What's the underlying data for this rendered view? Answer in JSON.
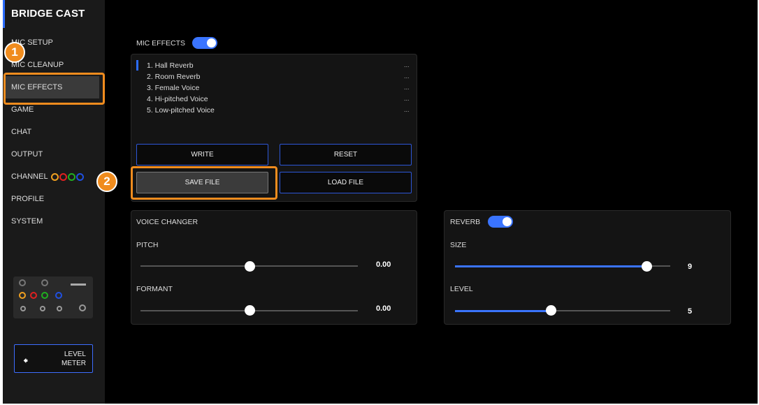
{
  "app": {
    "title": "BRIDGE CAST"
  },
  "sidebar": {
    "items": [
      {
        "label": "MIC SETUP"
      },
      {
        "label": "MIC CLEANUP"
      },
      {
        "label": "MIC EFFECTS"
      },
      {
        "label": "GAME"
      },
      {
        "label": "CHAT"
      },
      {
        "label": "OUTPUT"
      },
      {
        "label": "CHANNEL"
      },
      {
        "label": "PROFILE"
      },
      {
        "label": "SYSTEM"
      }
    ],
    "channel_colors": [
      "#f0a020",
      "#e02020",
      "#20b020",
      "#2050e0"
    ],
    "level_meter_label": "LEVEL\nMETER",
    "level_meter_icon": "arrow-left-icon"
  },
  "mic_effects": {
    "header": "MIC EFFECTS",
    "enabled": true,
    "presets": [
      {
        "label": "1. Hall Reverb",
        "menu": "..."
      },
      {
        "label": "2. Room Reverb",
        "menu": "..."
      },
      {
        "label": "3. Female Voice",
        "menu": "..."
      },
      {
        "label": "4. Hi-pitched Voice",
        "menu": "..."
      },
      {
        "label": "5. Low-pitched Voice",
        "menu": "..."
      }
    ],
    "buttons": {
      "write": "WRITE",
      "reset": "RESET",
      "save_file": "SAVE FILE",
      "load_file": "LOAD FILE"
    }
  },
  "voice_changer": {
    "header": "VOICE CHANGER",
    "pitch": {
      "label": "PITCH",
      "value": "0.00",
      "level": 0.5
    },
    "formant": {
      "label": "FORMANT",
      "value": "0.00",
      "level": 0.5
    }
  },
  "reverb": {
    "header": "REVERB",
    "enabled": true,
    "size": {
      "label": "SIZE",
      "value": "9",
      "level": 0.9
    },
    "level": {
      "label": "LEVEL",
      "value": "5",
      "level": 0.45
    }
  },
  "callouts": {
    "one": "1",
    "two": "2"
  },
  "colors": {
    "accent": "#3a74ff",
    "highlight": "#f08c1e"
  }
}
